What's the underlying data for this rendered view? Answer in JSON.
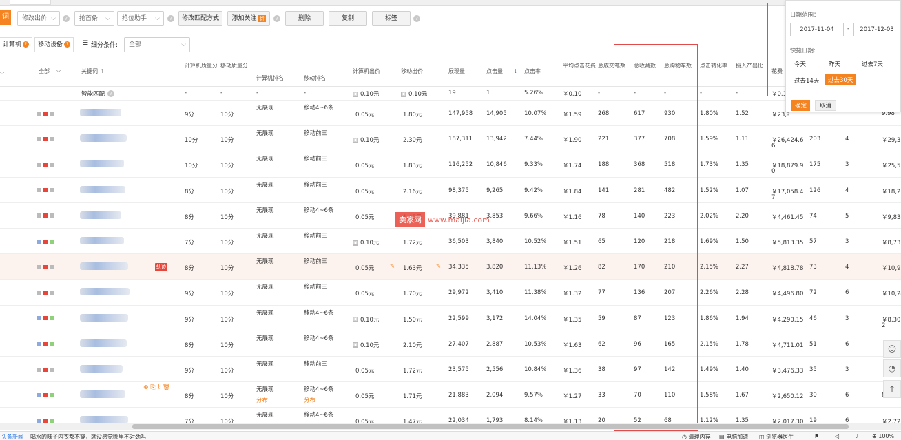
{
  "toolbar": {
    "left_tab": "词",
    "modify_bid": "修改出价",
    "rank_shrink": "抢首条",
    "rank_helper": "抢位助手",
    "modify_match": "修改匹配方式",
    "add_follow": "添加关注",
    "new_badge": "新",
    "delete": "删除",
    "copy": "复制",
    "tag": "标签"
  },
  "filter": {
    "pc": "计算机",
    "mobile": "移动设备",
    "sub_condition": "细分条件:",
    "sub_value": "全部"
  },
  "headers": {
    "all": "全部",
    "keyword": "关键词",
    "pc_quality": "计算机质量分",
    "mobile_quality": "移动质量分",
    "pc_rank": "计算机排名",
    "mobile_rank": "移动排名",
    "pc_bid": "计算机出价",
    "mobile_bid": "移动出价",
    "impressions": "展现量",
    "clicks": "点击量",
    "ctr": "点击率",
    "avg_cpc": "平均点击花费",
    "total_deals": "总成交笔数",
    "fav_items": "总收藏数",
    "cart": "总购物车数",
    "conv_rate": "点击转化率",
    "roi": "投入产出比",
    "cost": "花费"
  },
  "smart_row": {
    "keyword": "智能匹配",
    "pc_quality": "-",
    "mobile_quality": "-",
    "pc_rank": "-",
    "mobile_rank": "-",
    "pc_bid": "0.10元",
    "mobile_bid": "0.10元",
    "impressions": "19",
    "clicks": "1",
    "ctr": "5.26%",
    "avg_cpc": "￥0.10",
    "total_deals": "-",
    "fav_items": "-",
    "cart": "-",
    "conv_rate": "-",
    "roi": "-",
    "cost": "￥0.1"
  },
  "rows": [
    {
      "pcq": "9分",
      "mq": "10分",
      "pcr": "无展现",
      "mr": "移动4~6条",
      "pcb": "0.05元",
      "mb": "1.80元",
      "imp": "147,958",
      "clk": "14,905",
      "ctr": "10.07%",
      "cpc": "￥1.59",
      "deals": "268",
      "fav": "617",
      "cart": "930",
      "conv": "1.80%",
      "roi": "1.52",
      "cost": "￥23,?",
      "c2": "",
      "c3": "",
      "c4": "9.98"
    },
    {
      "pcq": "10分",
      "mq": "10分",
      "pcr": "无展现",
      "mr": "移动前三",
      "pcb": "0.10元",
      "mb": "2.30元",
      "imp": "187,311",
      "clk": "13,942",
      "ctr": "7.44%",
      "cpc": "￥1.90",
      "deals": "221",
      "fav": "377",
      "cart": "708",
      "conv": "1.59%",
      "roi": "1.11",
      "cost": "￥26,424.6",
      "cost2": "6",
      "c2": "203",
      "c3": "4",
      "c4": "￥29,32"
    },
    {
      "pcq": "10分",
      "mq": "10分",
      "pcr": "无展现",
      "mr": "移动前三",
      "pcb": "0.05元",
      "mb": "1.83元",
      "imp": "116,252",
      "clk": "10,846",
      "ctr": "9.33%",
      "cpc": "￥1.74",
      "deals": "188",
      "fav": "368",
      "cart": "518",
      "conv": "1.73%",
      "roi": "1.35",
      "cost": "￥18,879.9",
      "cost2": "0",
      "c2": "175",
      "c3": "3",
      "c4": "￥25,5"
    },
    {
      "pcq": "8分",
      "mq": "10分",
      "pcr": "无展现",
      "mr": "移动前三",
      "pcb": "0.05元",
      "mb": "2.16元",
      "imp": "98,375",
      "clk": "9,265",
      "ctr": "9.42%",
      "cpc": "￥1.84",
      "deals": "141",
      "fav": "281",
      "cart": "482",
      "conv": "1.52%",
      "roi": "1.07",
      "cost": "￥17,058.4",
      "cost2": "7",
      "c2": "126",
      "c3": "4",
      "c4": "￥18,2"
    },
    {
      "pcq": "8分",
      "mq": "10分",
      "pcr": "无展现",
      "mr": "移动4~6条",
      "pcb": "0.05元",
      "mb": "1.45元",
      "imp": "39,881",
      "clk": "3,853",
      "ctr": "9.66%",
      "cpc": "￥1.16",
      "deals": "78",
      "fav": "140",
      "cart": "223",
      "conv": "2.02%",
      "roi": "2.20",
      "cost": "￥4,461.45",
      "c2": "74",
      "c3": "5",
      "c4": "￥9,834"
    },
    {
      "pcq": "7分",
      "mq": "10分",
      "pcr": "无展现",
      "mr": "移动前三",
      "pcb": "0.10元",
      "mb": "1.72元",
      "imp": "36,503",
      "clk": "3,840",
      "ctr": "10.52%",
      "cpc": "￥1.51",
      "deals": "65",
      "fav": "120",
      "cart": "218",
      "conv": "1.69%",
      "roi": "1.50",
      "cost": "￥5,813.35",
      "c2": "57",
      "c3": "3",
      "c4": "￥8,732"
    },
    {
      "pcq": "8分",
      "mq": "10分",
      "pcr": "无展现",
      "mr": "移动前三",
      "pcb": "0.05元",
      "mb": "1.63元",
      "imp": "34,335",
      "clk": "3,820",
      "ctr": "11.13%",
      "cpc": "￥1.26",
      "deals": "82",
      "fav": "170",
      "cart": "210",
      "conv": "2.15%",
      "roi": "2.27",
      "cost": "￥4,818.78",
      "c2": "73",
      "c3": "4",
      "c4": "￥10,9"
    },
    {
      "pcq": "9分",
      "mq": "10分",
      "pcr": "无展现",
      "mr": "移动前三",
      "pcb": "0.05元",
      "mb": "1.70元",
      "imp": "29,972",
      "clk": "3,410",
      "ctr": "11.38%",
      "cpc": "￥1.32",
      "deals": "77",
      "fav": "136",
      "cart": "207",
      "conv": "2.26%",
      "roi": "2.28",
      "cost": "￥4,496.80",
      "c2": "72",
      "c3": "6",
      "c4": "￥10,24"
    },
    {
      "pcq": "9分",
      "mq": "10分",
      "pcr": "无展现",
      "mr": "移动4~6条",
      "pcb": "0.10元",
      "mb": "1.50元",
      "imp": "22,599",
      "clk": "3,172",
      "ctr": "14.04%",
      "cpc": "￥1.35",
      "deals": "59",
      "fav": "87",
      "cart": "123",
      "conv": "1.86%",
      "roi": "1.94",
      "cost": "￥4,290.15",
      "c2": "46",
      "c3": "3",
      "c4": "￥8,302",
      "c5": "2"
    },
    {
      "pcq": "8分",
      "mq": "10分",
      "pcr": "无展现",
      "mr": "移动4~6条",
      "pcb": "0.10元",
      "mb": "2.10元",
      "imp": "27,407",
      "clk": "2,887",
      "ctr": "10.53%",
      "cpc": "￥1.63",
      "deals": "62",
      "fav": "96",
      "cart": "165",
      "conv": "2.15%",
      "roi": "1.78",
      "cost": "￥4,711.01",
      "c2": "51",
      "c3": "6",
      "c4": ""
    },
    {
      "pcq": "9分",
      "mq": "10分",
      "pcr": "无展现",
      "mr": "移动前三",
      "pcb": "0.05元",
      "mb": "1.72元",
      "imp": "23,575",
      "clk": "2,556",
      "ctr": "10.84%",
      "cpc": "￥1.36",
      "deals": "38",
      "fav": "97",
      "cart": "142",
      "conv": "1.49%",
      "roi": "1.40",
      "cost": "￥3,476.33",
      "c2": "35",
      "c3": "3",
      "c4": ""
    },
    {
      "pcq": "8分",
      "mq": "10分",
      "pcr": "无展现",
      "mr": "移动4~6条",
      "pcb": "0.05元",
      "mb": "1.71元",
      "imp": "21,883",
      "clk": "2,094",
      "ctr": "9.57%",
      "cpc": "￥1.27",
      "deals": "33",
      "fav": "70",
      "cart": "110",
      "conv": "1.58%",
      "roi": "1.67",
      "cost": "￥2,650.12",
      "c2": "30",
      "c3": "6",
      "c4": "8",
      "sub": "分布"
    },
    {
      "pcq": "7分",
      "mq": "10分",
      "pcr": "无展现",
      "mr": "移动4~6条",
      "pcb": "0.05元",
      "mb": "1.47元",
      "imp": "22,034",
      "clk": "1,793",
      "ctr": "8.14%",
      "cpc": "￥1.13",
      "deals": "20",
      "fav": "52",
      "cart": "68",
      "conv": "1.12%",
      "roi": "1.35",
      "cost": "￥2,017.30",
      "c2": "19",
      "c3": "6",
      "c4": "￥2,72"
    }
  ],
  "track_badge": "轨迹",
  "datepanel": {
    "range_label": "日期范围：",
    "start": "2017-11-04",
    "end": "2017-12-03",
    "quick_label": "快捷日期:",
    "today": "今天",
    "yesterday": "昨天",
    "last7": "过去7天",
    "last14": "过去14天",
    "last30": "过去30天",
    "ok": "确定",
    "cancel": "取消"
  },
  "watermark": {
    "left": "卖家网",
    "right": "www.maijia.com"
  },
  "statusbar": {
    "news": "头条新闻",
    "headline": "喝水的味子内衣都不穿，就没感觉哪里不对劲吗",
    "mem": "清理内存",
    "speed": "电脑加速",
    "doctor": "浏览器医生",
    "zoom": "100%"
  },
  "colors": {
    "accent": "#f5831f",
    "highlight_row": "#fdf3ee",
    "annot_red": "#e04b4b"
  }
}
